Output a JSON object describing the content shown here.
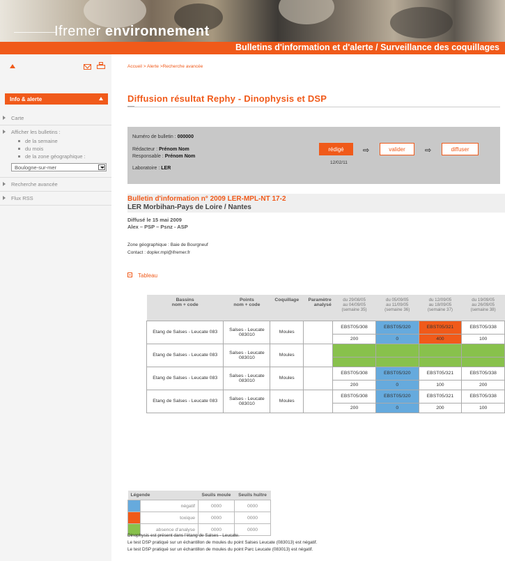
{
  "header": {
    "brand_light": "Ifremer",
    "brand_bold": "environnement",
    "bar_title": "Bulletins d'information et d'alerte / Surveillance des coquillages"
  },
  "sidebar": {
    "section_title": "Info & alerte",
    "items": [
      {
        "label": "Carte"
      },
      {
        "label": "Afficher les bulletins :"
      },
      {
        "label": "Recherche avancée"
      },
      {
        "label": "Flux RSS"
      }
    ],
    "sub_items": [
      "de la semaine",
      "du mois",
      "de la zone géographique :"
    ],
    "zone_select": "Boulogne-sur-mer"
  },
  "breadcrumb": "Accueil > Alerte >Recherche avancée",
  "page_title": "Diffusion résultat Rephy - Dinophysis et DSP",
  "workflow": {
    "bulletin_label": "Numéro de bulletin :",
    "bulletin_value": "000000",
    "redacteur_label": "Rédacteur :",
    "redacteur_value": "Prénom Nom",
    "responsable_label": "Responsable :",
    "responsable_value": "Prénom Nom",
    "labo_label": "Laboratoire :",
    "labo_value": "LER",
    "step1": "rédigé",
    "step2": "valider",
    "step3": "diffuser",
    "arrow": "⇨",
    "date": "12/02/11"
  },
  "bulletin": {
    "title": "Bulletin d'information n° 2009 LER-MPL-NT 17-2",
    "subtitle": "LER Morbihan-Pays de Loire / Nantes",
    "diffuse": "Diffusé le 15 mai 2009",
    "toxins": "Alex – PSP – Psnz - ASP",
    "zone": "Zone géographique : Baie de Bourgneuf",
    "contact": "Contact : dopler.mpl@ifremer.fr",
    "tableau_toggle": "Tableau"
  },
  "table": {
    "headers": {
      "bassins": [
        "Bassins",
        "nom + code"
      ],
      "points": [
        "Points",
        "nom + code"
      ],
      "coquillage": "Coquillage",
      "parametre": [
        "Paramètre",
        "analysé"
      ],
      "periods": [
        [
          "du 29/08/05",
          "au 04/09/05",
          "(semaine 35)"
        ],
        [
          "du 05/09/05",
          "au 11/09/05",
          "(semaine 36)"
        ],
        [
          "du 12/09/05",
          "au 18/09/05",
          "(semaine 37)"
        ],
        [
          "du 19/09/05",
          "au 26/09/05",
          "(semaine 38)"
        ]
      ]
    },
    "rows": [
      {
        "site": "Etang de Salses - Leucate 083",
        "point": [
          "Salses - Leucate",
          "083010"
        ],
        "coquillage": "Moules",
        "codes": [
          "EBST05/308",
          "EBST05/320",
          "EBST05/321",
          "EBST05/338"
        ],
        "values": [
          "200",
          "0",
          "400",
          "100"
        ],
        "status": [
          "",
          "negatif",
          "toxique",
          ""
        ]
      },
      {
        "site": "Etang de Salses - Leucate 083",
        "point": [
          "Salses - Leucate",
          "083010"
        ],
        "coquillage": "Moules",
        "codes": [
          "",
          "",
          "",
          ""
        ],
        "values": [
          "",
          "",
          "",
          ""
        ],
        "status": [
          "absence",
          "absence",
          "absence",
          "absence"
        ]
      },
      {
        "site": "Etang de Salses - Leucate 083",
        "point": [
          "Salses - Leucate",
          "083010"
        ],
        "coquillage": "Moules",
        "codes": [
          "EBST05/308",
          "EBST05/320",
          "EBST05/321",
          "EBST05/338"
        ],
        "values": [
          "200",
          "0",
          "100",
          "200"
        ],
        "status": [
          "",
          "negatif",
          "",
          ""
        ]
      },
      {
        "site": "Etang de Salses - Leucate 083",
        "point": [
          "Salses - Leucate",
          "083010"
        ],
        "coquillage": "Moules",
        "codes": [
          "EBST05/308",
          "EBST05/320",
          "EBST05/321",
          "EBST05/338"
        ],
        "values": [
          "200",
          "0",
          "200",
          "100"
        ],
        "status": [
          "",
          "negatif",
          "",
          ""
        ]
      }
    ]
  },
  "legend": {
    "title": "Légende",
    "col1": "Seuils moule",
    "col2": "Seuils huître",
    "rows": [
      {
        "label": "négatif",
        "color": "#66aadd",
        "v1": "0000",
        "v2": "0000"
      },
      {
        "label": "toxique",
        "color": "#f05a1a",
        "v1": "0000",
        "v2": "0000"
      },
      {
        "label": "absence d'analyse",
        "color": "#88c14c",
        "v1": "0000",
        "v2": "0000"
      }
    ]
  },
  "footer": [
    "Dinophysis est présent dans l'étang de Salses - Leucate.",
    "Le test DSP pratiqué sur un échantillon de moules du point Salses Leucate (083013) est négatif.",
    "Le test DSP pratiqué sur un échantillon de moules du point Parc Leucate (083013) est négatif."
  ]
}
